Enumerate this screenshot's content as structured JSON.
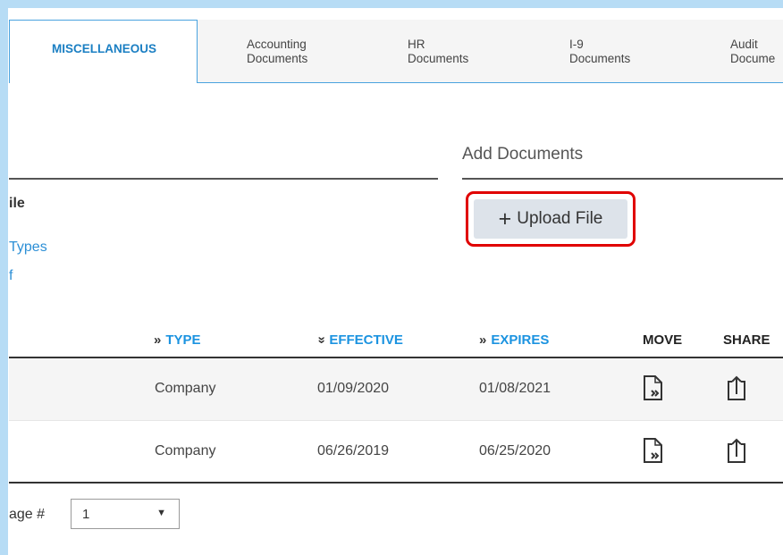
{
  "tabs": [
    {
      "label": "MISCELLANEOUS",
      "active": true
    },
    {
      "label_line1": "Accounting",
      "label_line2": "Documents"
    },
    {
      "label_line1": "HR",
      "label_line2": "Documents"
    },
    {
      "label_line1": "I-9",
      "label_line2": "Documents"
    },
    {
      "label_line1": "Audit",
      "label_line2": "Docume"
    }
  ],
  "left": {
    "file_label": "ile",
    "types_link": "Types",
    "f_link": "f"
  },
  "add_documents": {
    "title": "Add Documents",
    "upload_label": "Upload File",
    "upload_icon": "plus-icon"
  },
  "table": {
    "columns": [
      {
        "label": "TYPE",
        "sort_icon": "»"
      },
      {
        "label": "EFFECTIVE",
        "sort_icon": "«"
      },
      {
        "label": "EXPIRES",
        "sort_icon": "»"
      },
      {
        "label": "MOVE"
      },
      {
        "label": "SHARE"
      }
    ],
    "rows": [
      {
        "type": "Company",
        "effective": "01/09/2020",
        "expires": "01/08/2021",
        "move_icon": "move-document-icon",
        "share_icon": "share-icon"
      },
      {
        "type": "Company",
        "effective": "06/26/2019",
        "expires": "06/25/2020",
        "move_icon": "move-document-icon",
        "share_icon": "share-icon"
      }
    ]
  },
  "pager": {
    "label": "age #",
    "value": "1"
  },
  "colors": {
    "accent": "#1b93e0",
    "tab_border": "#4aa3df",
    "highlight": "#e00000",
    "button_bg": "#dde3ea"
  }
}
